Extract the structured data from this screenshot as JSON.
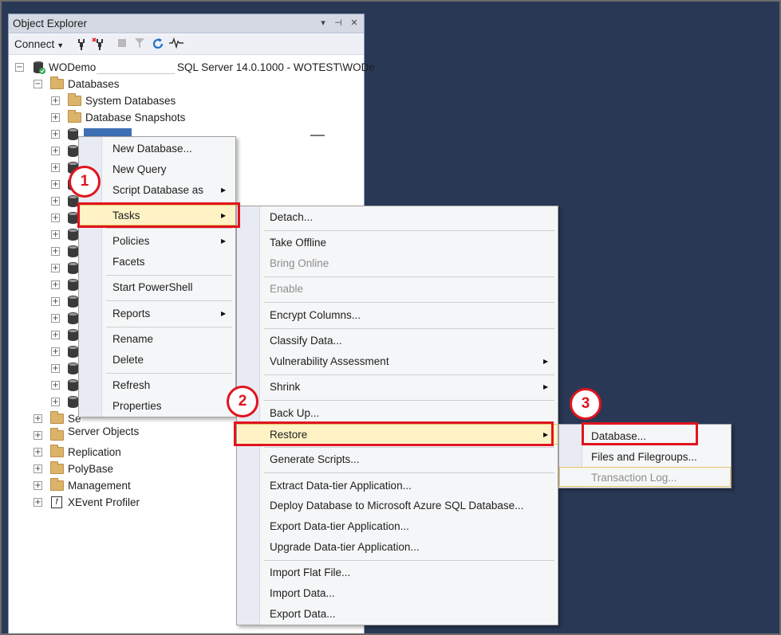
{
  "object_explorer": {
    "title": "Object Explorer",
    "title_controls": [
      "▾",
      "⊣",
      "✕"
    ],
    "toolbar": {
      "connect_label": "Connect",
      "icons": [
        "connect-icon",
        "disconnect-icon",
        "stop-icon",
        "filter-icon",
        "refresh-icon",
        "activity-monitor-icon"
      ]
    },
    "tree": {
      "server_prefix": "WODemo",
      "server_suffix": "SQL Server 14.0.1000 - WOTEST\\WODe",
      "databases": "Databases",
      "system_databases": "System Databases",
      "database_snapshots": "Database Snapshots",
      "security_partial": "Se",
      "server_objects": "Server Objects",
      "replication": "Replication",
      "polybase": "PolyBase",
      "management": "Management",
      "xevent_profiler": "XEvent Profiler"
    }
  },
  "context_menu": {
    "items": {
      "new_database": "New Database...",
      "new_query": "New Query",
      "script_database_as": "Script Database as",
      "tasks": "Tasks",
      "policies": "Policies",
      "facets": "Facets",
      "start_powershell": "Start PowerShell",
      "reports": "Reports",
      "rename": "Rename",
      "delete": "Delete",
      "refresh": "Refresh",
      "properties": "Properties"
    }
  },
  "tasks_menu": {
    "items": {
      "detach": "Detach...",
      "take_offline": "Take Offline",
      "bring_online": "Bring Online",
      "enable": "Enable",
      "encrypt_columns": "Encrypt Columns...",
      "classify_data": "Classify Data...",
      "vulnerability_assessment": "Vulnerability Assessment",
      "shrink": "Shrink",
      "back_up": "Back Up...",
      "restore": "Restore",
      "generate_scripts": "Generate Scripts...",
      "extract_dac": "Extract Data-tier Application...",
      "deploy_azure": "Deploy Database to Microsoft Azure SQL Database...",
      "export_dac": "Export Data-tier Application...",
      "upgrade_dac": "Upgrade Data-tier Application...",
      "import_flat_file": "Import Flat File...",
      "import_data": "Import Data...",
      "export_data": "Export Data..."
    }
  },
  "restore_menu": {
    "items": {
      "database": "Database...",
      "files_filegroups": "Files and Filegroups...",
      "transaction_log": "Transaction Log..."
    }
  },
  "callouts": [
    "1",
    "2",
    "3"
  ],
  "colors": {
    "background": "#293955",
    "highlight": "#fff3c6",
    "callout_red": "#e0141e",
    "folder": "#dcb36a"
  }
}
